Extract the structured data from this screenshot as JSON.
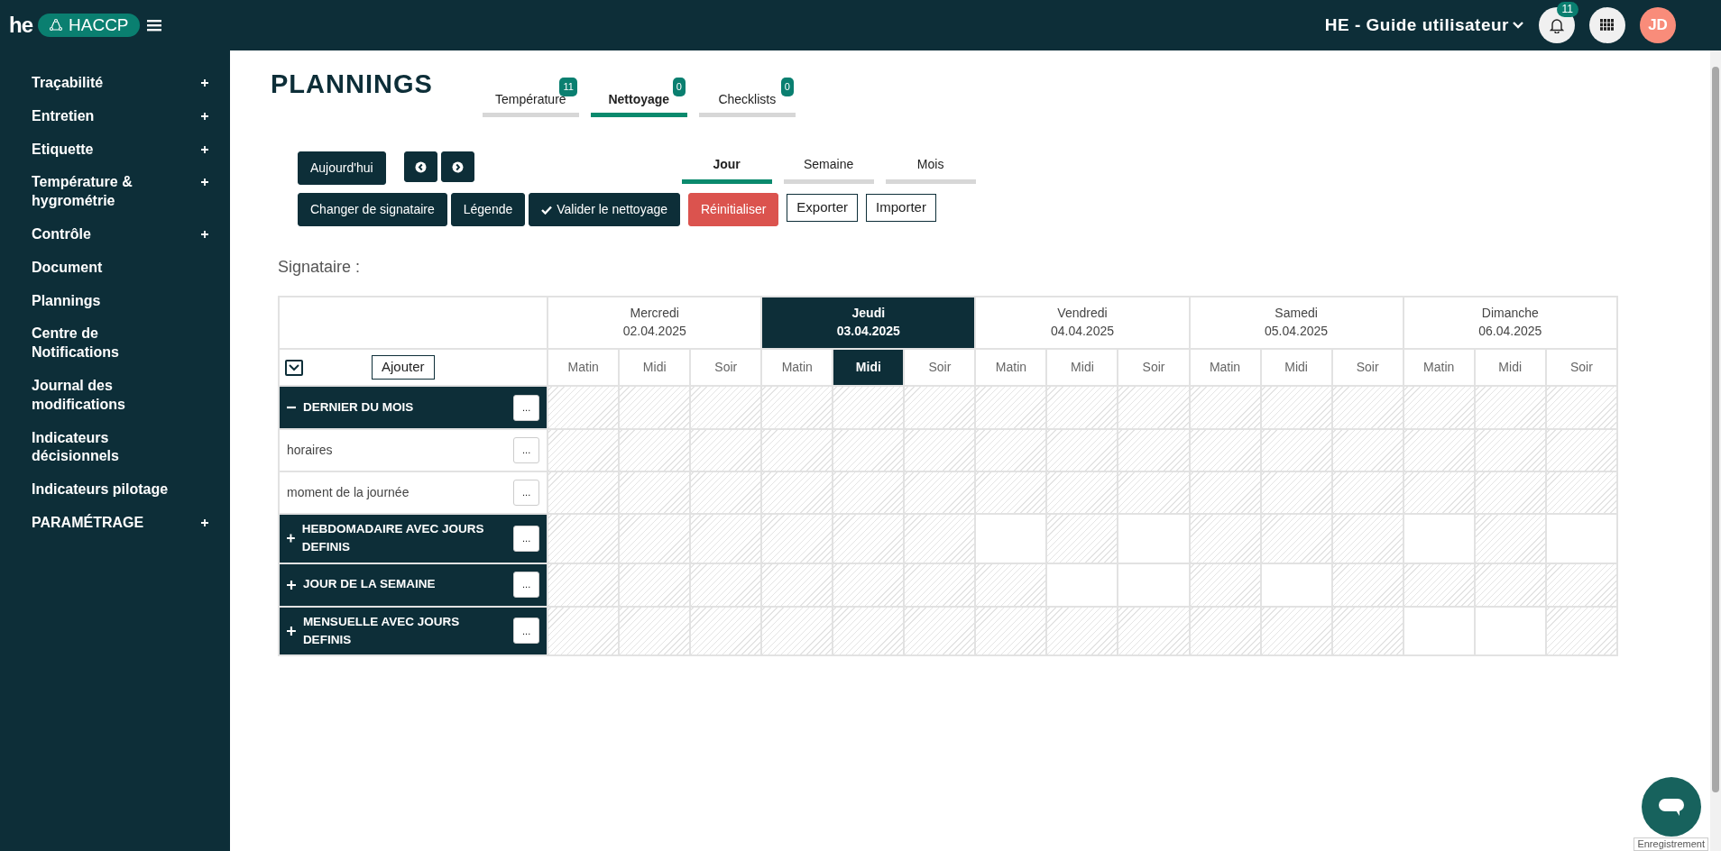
{
  "topbar": {
    "logo": "he",
    "app_pill": "HACCP",
    "account": "HE - Guide utilisateur",
    "notifications_count": "11",
    "avatar_initials": "JD"
  },
  "sidebar": {
    "items": [
      {
        "label": "Traçabilité",
        "expandable": true
      },
      {
        "label": "Entretien",
        "expandable": true
      },
      {
        "label": "Etiquette",
        "expandable": true
      },
      {
        "label": "Température & hygrométrie",
        "expandable": true
      },
      {
        "label": "Contrôle",
        "expandable": true
      },
      {
        "label": "Document",
        "expandable": false
      },
      {
        "label": "Plannings",
        "expandable": false
      },
      {
        "label": "Centre de Notifications",
        "expandable": false
      },
      {
        "label": "Journal des modifications",
        "expandable": false
      },
      {
        "label": "Indicateurs décisionnels",
        "expandable": false
      },
      {
        "label": "Indicateurs pilotage",
        "expandable": false
      },
      {
        "label": "PARAMÉTRAGE",
        "expandable": true
      }
    ]
  },
  "page_title": "PLANNINGS",
  "tabs": [
    {
      "label": "Température",
      "count": "11",
      "selected": false
    },
    {
      "label": "Nettoyage",
      "count": "0",
      "selected": true
    },
    {
      "label": "Checklists",
      "count": "0",
      "selected": false
    }
  ],
  "nav_buttons": {
    "today": "Aujourd'hui"
  },
  "view_tabs": [
    {
      "label": "Jour",
      "selected": true
    },
    {
      "label": "Semaine",
      "selected": false
    },
    {
      "label": "Mois",
      "selected": false
    }
  ],
  "actions": [
    {
      "label": "Changer de signataire",
      "kind": "dark"
    },
    {
      "label": "Légende",
      "kind": "dark"
    },
    {
      "label": "Valider le nettoyage",
      "kind": "check"
    },
    {
      "label": "Réinitialiser",
      "kind": "danger"
    },
    {
      "label": "Exporter",
      "kind": "outline"
    },
    {
      "label": "Importer",
      "kind": "outline"
    }
  ],
  "signatory_label": "Signataire :",
  "planner": {
    "add_button": "Ajouter",
    "days": [
      {
        "name": "Mercredi",
        "date": "02.04.2025",
        "selected": false,
        "slots": [
          {
            "label": "Matin",
            "selected": false
          },
          {
            "label": "Midi",
            "selected": false
          },
          {
            "label": "Soir",
            "selected": false
          }
        ]
      },
      {
        "name": "Jeudi",
        "date": "03.04.2025",
        "selected": true,
        "slots": [
          {
            "label": "Matin",
            "selected": false
          },
          {
            "label": "Midi",
            "selected": true
          },
          {
            "label": "Soir",
            "selected": false
          }
        ]
      },
      {
        "name": "Vendredi",
        "date": "04.04.2025",
        "selected": false,
        "slots": [
          {
            "label": "Matin",
            "selected": false
          },
          {
            "label": "Midi",
            "selected": false
          },
          {
            "label": "Soir",
            "selected": false
          }
        ]
      },
      {
        "name": "Samedi",
        "date": "05.04.2025",
        "selected": false,
        "slots": [
          {
            "label": "Matin",
            "selected": false
          },
          {
            "label": "Midi",
            "selected": false
          },
          {
            "label": "Soir",
            "selected": false
          }
        ]
      },
      {
        "name": "Dimanche",
        "date": "06.04.2025",
        "selected": false,
        "slots": [
          {
            "label": "Matin",
            "selected": false
          },
          {
            "label": "Midi",
            "selected": false
          },
          {
            "label": "Soir",
            "selected": false
          }
        ]
      }
    ],
    "groups": [
      {
        "label": "DERNIER DU MOIS",
        "menu": "...",
        "expanded": true,
        "hatched": [
          true,
          true,
          true,
          true,
          true,
          true,
          true,
          true,
          true,
          true,
          true,
          true,
          true,
          true,
          true
        ],
        "children": [
          {
            "label": "horaires",
            "menu": "...",
            "hatched": [
              true,
              true,
              true,
              true,
              true,
              true,
              true,
              true,
              true,
              true,
              true,
              true,
              true,
              true,
              true
            ]
          },
          {
            "label": "moment de la journée",
            "menu": "...",
            "hatched": [
              true,
              true,
              true,
              true,
              true,
              true,
              true,
              true,
              true,
              true,
              true,
              true,
              true,
              true,
              true
            ]
          }
        ]
      },
      {
        "label": "HEBDOMADAIRE AVEC JOURS DEFINIS",
        "menu": "...",
        "expanded": false,
        "hatched": [
          true,
          true,
          true,
          true,
          true,
          true,
          false,
          true,
          false,
          true,
          true,
          true,
          false,
          true,
          false
        ]
      },
      {
        "label": "JOUR DE LA SEMAINE",
        "menu": "...",
        "expanded": false,
        "hatched": [
          true,
          true,
          true,
          true,
          true,
          true,
          true,
          false,
          false,
          true,
          false,
          true,
          true,
          true,
          true
        ]
      },
      {
        "label": "MENSUELLE AVEC JOURS DEFINIS",
        "menu": "...",
        "expanded": false,
        "hatched": [
          true,
          true,
          true,
          true,
          true,
          true,
          true,
          true,
          true,
          true,
          true,
          true,
          false,
          false,
          true
        ]
      }
    ]
  },
  "tooltip": "Enregistrement"
}
